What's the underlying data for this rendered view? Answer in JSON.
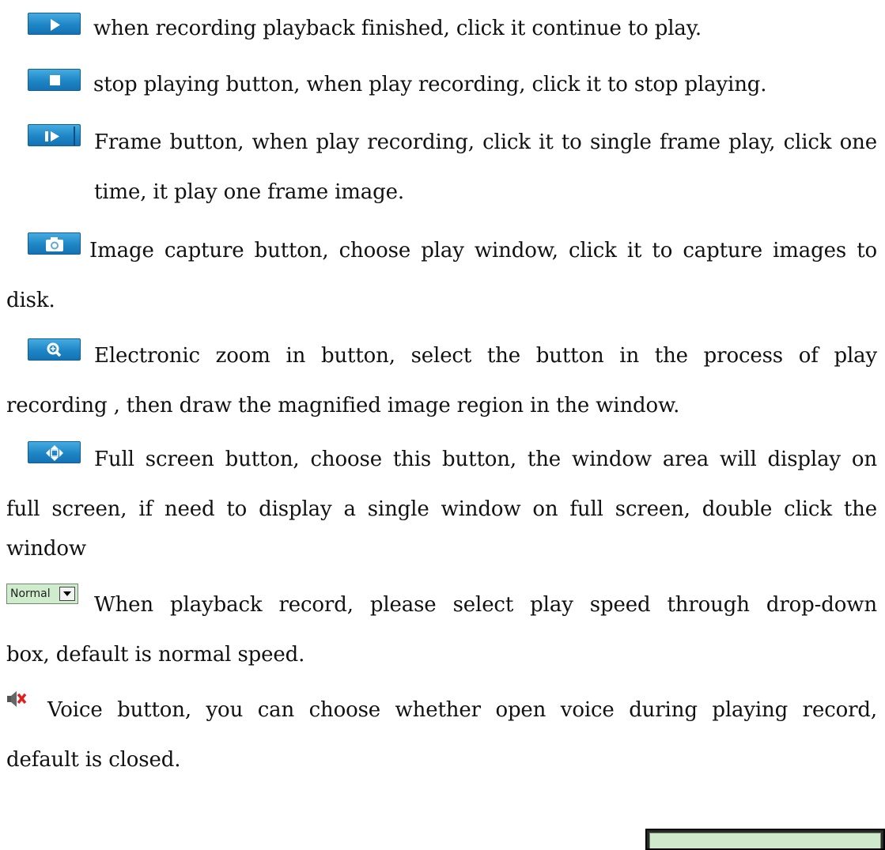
{
  "lines": [
    "when recording playback finished, click it continue to play.",
    "stop playing button, when play recording, click it to stop playing.",
    "Frame button, when play recording, click it to single frame play, click one",
    "time, it play one frame image.",
    "Image capture button, choose play window, click it to capture images to",
    "disk.",
    "Electronic zoom in button, select the button in the process of play",
    "recording , then draw the magnified image region in the window.",
    "Full screen button, choose this button, the window area will display on",
    "full screen, if need to display a single window on full screen, double click the",
    "window",
    "When playback record, please select play speed through drop-down",
    "box, default is normal speed.",
    "Voice button, you can choose whether open voice during playing record,",
    "default is closed."
  ],
  "speed_combo": {
    "value": "Normal"
  },
  "icons": {
    "play": "play-icon",
    "stop": "stop-icon",
    "frame": "frame-step-icon",
    "capture": "camera-icon",
    "zoom": "zoom-in-icon",
    "fullscreen": "fullscreen-icon",
    "voice": "speaker-muted-icon"
  },
  "colors": {
    "icon_blue": "#1e86c6",
    "combo_bg": "#cfeccd",
    "mute_red": "#e02020"
  }
}
